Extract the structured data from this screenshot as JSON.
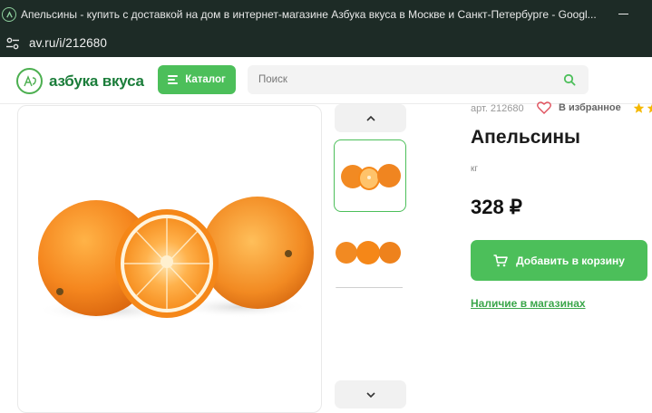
{
  "browser": {
    "window_title": "Апельсины - купить с доставкой на дом в интернет-магазине Азбука вкуса в Москве и Санкт-Петербурге - Googl...",
    "url": "av.ru/i/212680"
  },
  "header": {
    "logo_text": "азбука вкуса",
    "catalog_label": "Каталог",
    "search_placeholder": "Поиск"
  },
  "product": {
    "sku": "арт. 212680",
    "favorite_label": "В избранное",
    "title": "Апельсины",
    "unit": "кг",
    "price": "328 ₽",
    "add_to_cart_label": "Добавить в корзину",
    "availability_link": "Наличие в магазинах"
  },
  "gallery": {
    "thumbnails": [
      {
        "name": "oranges-cut-thumb",
        "active": true
      },
      {
        "name": "oranges-whole-thumb",
        "active": false
      }
    ]
  },
  "icons": {
    "favicon": "abv-logo-icon",
    "site_info": "tune-icon",
    "search": "search-icon",
    "heart": "heart-icon",
    "star": "star-icon",
    "cart": "cart-icon",
    "up": "chevron-up-icon",
    "down": "chevron-down-icon"
  },
  "colors": {
    "brand_green": "#4cbf5a",
    "logo_green": "#1b7d3a",
    "browser_chrome": "#1d2b26",
    "star_yellow": "#f5b800"
  }
}
